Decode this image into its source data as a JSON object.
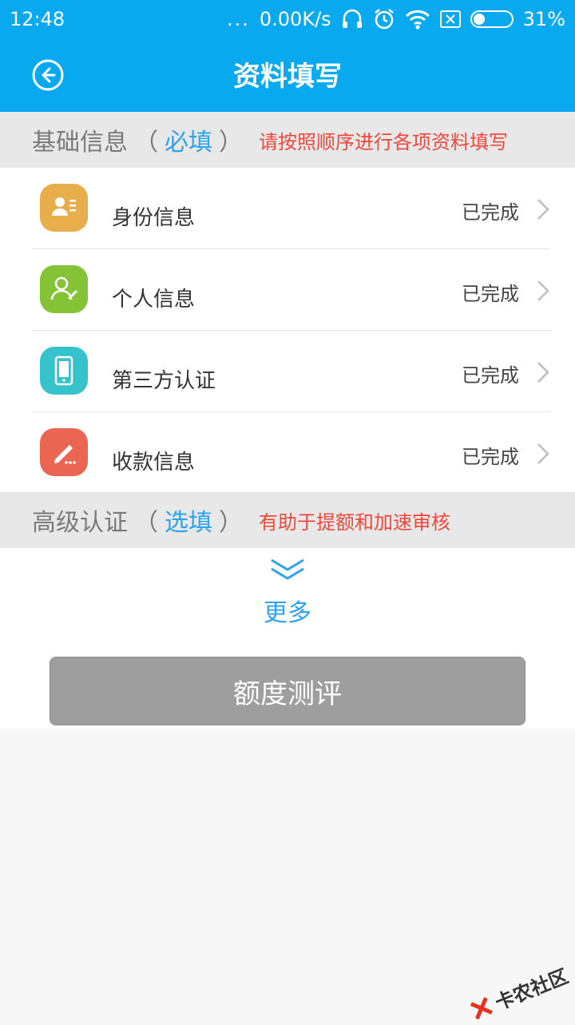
{
  "status_bar": {
    "time": "12:48",
    "dots": "...",
    "speed": "0.00K/s",
    "battery": "31%",
    "battery_level": 0.31,
    "icons": [
      "headphones-icon",
      "alarm-icon",
      "wifi-icon",
      "sim-icon",
      "battery-icon"
    ]
  },
  "nav": {
    "title": "资料填写",
    "back_icon": "back-circle-icon"
  },
  "basic_section": {
    "title": "基础信息",
    "paren_open": "（",
    "tag": "必填",
    "paren_close": "）",
    "note": "请按照顺序进行各项资料填写"
  },
  "items": [
    {
      "label": "身份信息",
      "status": "已完成",
      "icon": "id-card-icon",
      "color": "#e9ae4c"
    },
    {
      "label": "个人信息",
      "status": "已完成",
      "icon": "person-edit-icon",
      "color": "#84c236"
    },
    {
      "label": "第三方认证",
      "status": "已完成",
      "icon": "phone-icon",
      "color": "#36c3cc"
    },
    {
      "label": "收款信息",
      "status": "已完成",
      "icon": "pen-icon",
      "color": "#ea6653"
    }
  ],
  "advanced_section": {
    "title": "高级认证",
    "paren_open": "（",
    "tag": "选填",
    "paren_close": "）",
    "note": "有助于提额和加速审核"
  },
  "more": {
    "label": "更多",
    "icon": "double-chevron-down-icon"
  },
  "eval_button": {
    "label": "额度测评"
  },
  "watermark": {
    "text": "卡农社区"
  },
  "colors": {
    "primary": "#08a9ef",
    "accent_text": "#2ea2ec",
    "note_red": "#f3453a",
    "button_gray": "#9e9e9e"
  }
}
